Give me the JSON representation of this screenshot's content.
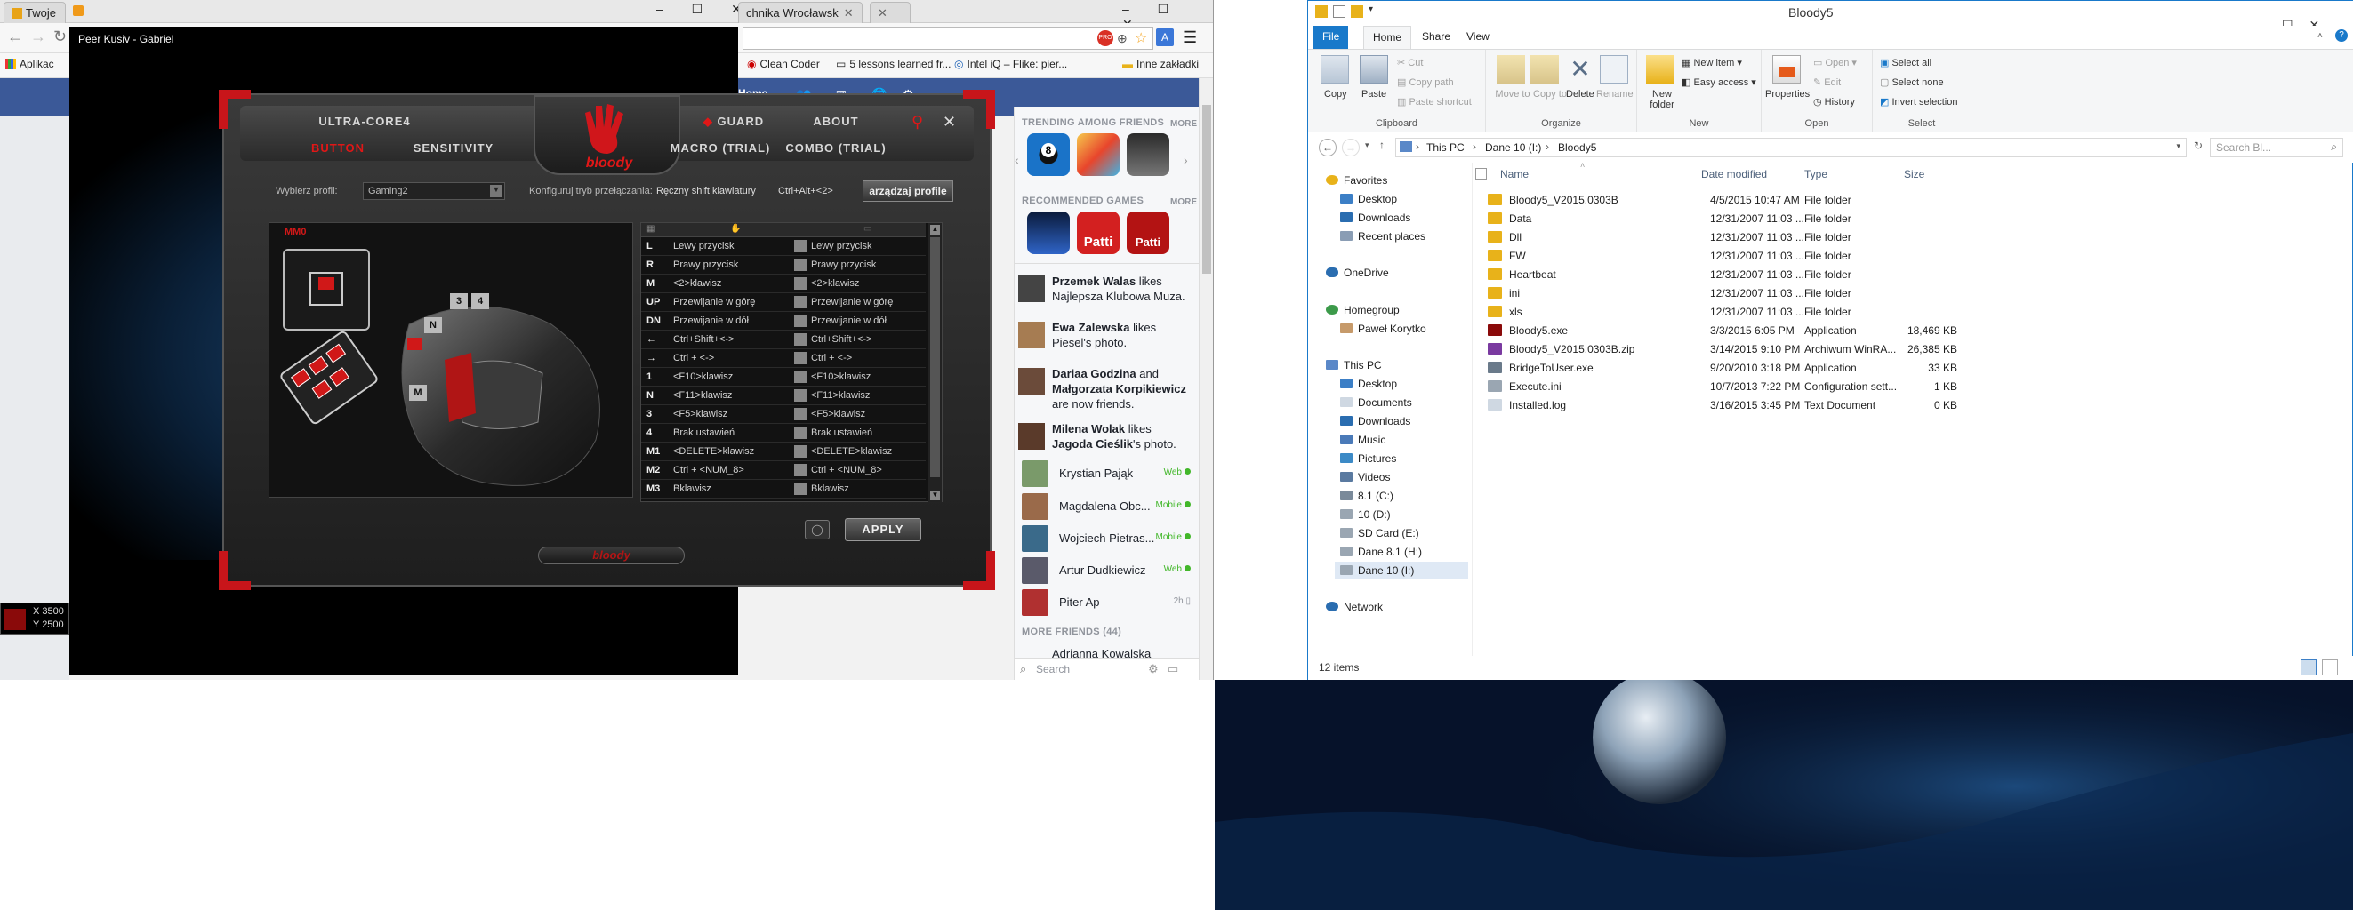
{
  "chrome": {
    "tab1": "Twoje",
    "tab2": "chnika Wrocławsk",
    "tab3": "",
    "bookmarks_apps": "Aplikac",
    "bookmarks": [
      "Clean Coder",
      "5 lessons learned fr...",
      "Intel iQ – Flike: pier...",
      "Inne zakładki"
    ],
    "fb_home": "Home",
    "video_title": "Peer Kusiv - Gabriel",
    "coords_x": "X 3500",
    "coords_y": "Y 2500"
  },
  "facebook": {
    "trending_label": "TRENDING AMONG FRIENDS",
    "more1": "MORE",
    "recommended_label": "RECOMMENDED GAMES",
    "more2": "MORE",
    "game_patti": "Patti",
    "stories": [
      {
        "bold1": "Przemek Walas",
        "text": " likes Najlepsza Klubowa Muza."
      },
      {
        "bold1": "Ewa Zalewska",
        "text": " likes Piesel's photo."
      },
      {
        "bold1": "Dariaa Godzina",
        "mid": " and ",
        "bold2": "Małgorzata Korpikiewicz",
        "text": " are now friends."
      },
      {
        "bold1": "Milena Wolak",
        "text": " likes ",
        "bold2": "Jagoda Cieślik",
        "text2": "'s photo."
      }
    ],
    "friends": [
      {
        "name": "Krystian Pająk",
        "status": "Web"
      },
      {
        "name": "Magdalena Obc...",
        "status": "Mobile"
      },
      {
        "name": "Wojciech Pietras...",
        "status": "Mobile"
      },
      {
        "name": "Artur Dudkiewicz",
        "status": "Web"
      },
      {
        "name": "Piter Ap",
        "status": "2h"
      }
    ],
    "more_friends": "MORE FRIENDS (44)",
    "next_friend": "Adrianna Kowalska",
    "search_placeholder": "Search"
  },
  "bloody": {
    "tabs_top": [
      "ULTRA-CORE4",
      "GUARD",
      "ABOUT"
    ],
    "tabs_bottom": [
      "BUTTON",
      "SENSITIVITY",
      "MACRO (TRIAL)",
      "COMBO (TRIAL)"
    ],
    "logo": "bloody",
    "profile_label": "Wybierz profil:",
    "profile_value": "Gaming2",
    "config_label": "Konfiguruj tryb przełączania:",
    "config_value": "Ręczny shift klawiatury",
    "config_shortcut": "Ctrl+Alt+<2>",
    "manage_button": "arządzaj profile",
    "mode_label": "MM0",
    "mouse_labels": [
      "N",
      "3",
      "4",
      "M"
    ],
    "rows": [
      {
        "key": "L",
        "a": "Lewy przycisk",
        "b": "Lewy przycisk"
      },
      {
        "key": "R",
        "a": "Prawy przycisk",
        "b": "Prawy przycisk"
      },
      {
        "key": "M",
        "a": "<2>klawisz",
        "b": "<2>klawisz"
      },
      {
        "key": "UP",
        "a": "Przewijanie w górę",
        "b": "Przewijanie w górę"
      },
      {
        "key": "DN",
        "a": "Przewijanie w dół",
        "b": "Przewijanie w dół"
      },
      {
        "key": "←",
        "a": "Ctrl+Shift+<->",
        "b": "Ctrl+Shift+<->"
      },
      {
        "key": "→",
        "a": "Ctrl + <->",
        "b": "Ctrl + <->"
      },
      {
        "key": "1",
        "a": "<F10>klawisz",
        "b": "<F10>klawisz"
      },
      {
        "key": "N",
        "a": "<F11>klawisz",
        "b": "<F11>klawisz"
      },
      {
        "key": "3",
        "a": "<F5>klawisz",
        "b": "<F5>klawisz"
      },
      {
        "key": "4",
        "a": "Brak ustawień",
        "b": "Brak ustawień"
      },
      {
        "key": "M1",
        "a": "<DELETE>klawisz",
        "b": "<DELETE>klawisz"
      },
      {
        "key": "M2",
        "a": "Ctrl + <NUM_8>",
        "b": "Ctrl + <NUM_8>"
      },
      {
        "key": "M3",
        "a": "Bklawisz",
        "b": "Bklawisz"
      }
    ],
    "apply": "APPLY",
    "footer_logo": "bloody"
  },
  "explorer": {
    "title": "Bloody5",
    "tabs": [
      "File",
      "Home",
      "Share",
      "View"
    ],
    "clipboard": {
      "copy": "Copy",
      "paste": "Paste",
      "cut": "Cut",
      "copy_path": "Copy path",
      "paste_shortcut": "Paste shortcut",
      "label": "Clipboard"
    },
    "organize": {
      "move_to": "Move to",
      "copy_to": "Copy to",
      "delete": "Delete",
      "rename": "Rename",
      "label": "Organize"
    },
    "new": {
      "new_folder": "New folder",
      "new_item": "New item",
      "easy_access": "Easy access",
      "label": "New"
    },
    "open": {
      "properties": "Properties",
      "open": "Open",
      "edit": "Edit",
      "history": "History",
      "label": "Open"
    },
    "select": {
      "select_all": "Select all",
      "select_none": "Select none",
      "invert": "Invert selection",
      "label": "Select"
    },
    "address": [
      "This PC",
      "Dane 10 (I:)",
      "Bloody5"
    ],
    "search_placeholder": "Search Bl...",
    "nav": {
      "favorites": "Favorites",
      "fav_items": [
        "Desktop",
        "Downloads",
        "Recent places"
      ],
      "onedrive": "OneDrive",
      "homegroup": "Homegroup",
      "hg_user": "Paweł Korytko",
      "thispc": "This PC",
      "pc_items": [
        "Desktop",
        "Documents",
        "Downloads",
        "Music",
        "Pictures",
        "Videos",
        "8.1 (C:)",
        "10 (D:)",
        "SD Card (E:)",
        "Dane 8.1 (H:)",
        "Dane 10 (I:)"
      ],
      "network": "Network"
    },
    "columns": [
      "Name",
      "Date modified",
      "Type",
      "Size"
    ],
    "files": [
      {
        "name": "Bloody5_V2015.0303B",
        "date": "4/5/2015 10:47 AM",
        "type": "File folder",
        "size": "",
        "kind": "folder"
      },
      {
        "name": "Data",
        "date": "12/31/2007 11:03 ...",
        "type": "File folder",
        "size": "",
        "kind": "folder"
      },
      {
        "name": "Dll",
        "date": "12/31/2007 11:03 ...",
        "type": "File folder",
        "size": "",
        "kind": "folder"
      },
      {
        "name": "FW",
        "date": "12/31/2007 11:03 ...",
        "type": "File folder",
        "size": "",
        "kind": "folder"
      },
      {
        "name": "Heartbeat",
        "date": "12/31/2007 11:03 ...",
        "type": "File folder",
        "size": "",
        "kind": "folder"
      },
      {
        "name": "ini",
        "date": "12/31/2007 11:03 ...",
        "type": "File folder",
        "size": "",
        "kind": "folder"
      },
      {
        "name": "xls",
        "date": "12/31/2007 11:03 ...",
        "type": "File folder",
        "size": "",
        "kind": "folder"
      },
      {
        "name": "Bloody5.exe",
        "date": "3/3/2015 6:05 PM",
        "type": "Application",
        "size": "18,469 KB",
        "kind": "exe"
      },
      {
        "name": "Bloody5_V2015.0303B.zip",
        "date": "3/14/2015 9:10 PM",
        "type": "Archiwum WinRA...",
        "size": "26,385 KB",
        "kind": "zip"
      },
      {
        "name": "BridgeToUser.exe",
        "date": "9/20/2010 3:18 PM",
        "type": "Application",
        "size": "33 KB",
        "kind": "exe2"
      },
      {
        "name": "Execute.ini",
        "date": "10/7/2013 7:22 PM",
        "type": "Configuration sett...",
        "size": "1 KB",
        "kind": "ini"
      },
      {
        "name": "Installed.log",
        "date": "3/16/2015 3:45 PM",
        "type": "Text Document",
        "size": "0 KB",
        "kind": "txt"
      }
    ],
    "status": "12 items"
  }
}
